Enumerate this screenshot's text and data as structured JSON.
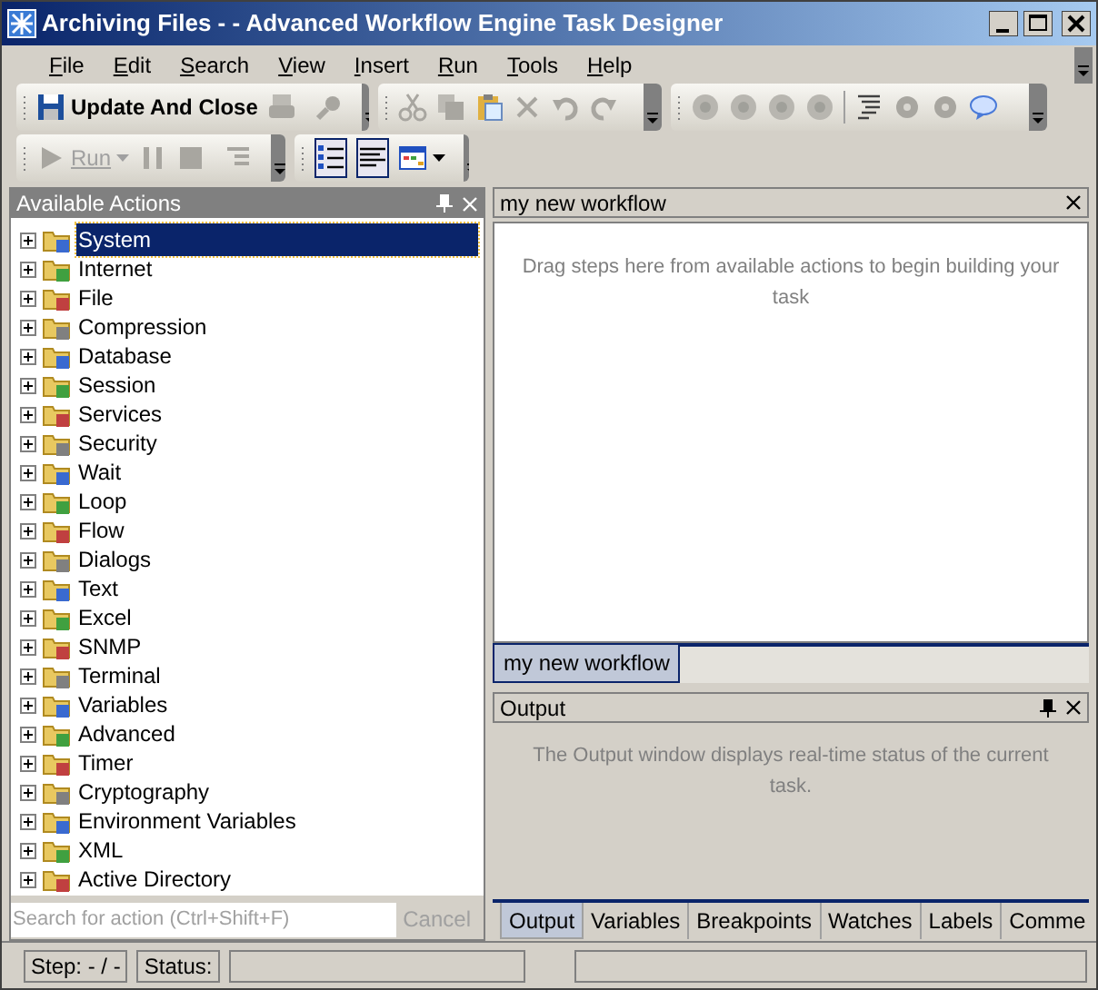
{
  "window": {
    "title": "Archiving Files -  - Advanced Workflow Engine Task Designer"
  },
  "menu": [
    "File",
    "Edit",
    "Search",
    "View",
    "Insert",
    "Run",
    "Tools",
    "Help"
  ],
  "toolbar": {
    "save_label": "Update And Close",
    "run_label": "Run",
    "view_buttons": [
      {
        "selected": true
      },
      {
        "selected": true
      }
    ]
  },
  "actions_panel": {
    "title": "Available Actions",
    "items": [
      {
        "label": "System",
        "selected": true
      },
      {
        "label": "Internet",
        "selected": false
      },
      {
        "label": "File",
        "selected": false
      },
      {
        "label": "Compression",
        "selected": false
      },
      {
        "label": "Database",
        "selected": false
      },
      {
        "label": "Session",
        "selected": false
      },
      {
        "label": "Services",
        "selected": false
      },
      {
        "label": "Security",
        "selected": false
      },
      {
        "label": "Wait",
        "selected": false
      },
      {
        "label": "Loop",
        "selected": false
      },
      {
        "label": "Flow",
        "selected": false
      },
      {
        "label": "Dialogs",
        "selected": false
      },
      {
        "label": "Text",
        "selected": false
      },
      {
        "label": "Excel",
        "selected": false
      },
      {
        "label": "SNMP",
        "selected": false
      },
      {
        "label": "Terminal",
        "selected": false
      },
      {
        "label": "Variables",
        "selected": false
      },
      {
        "label": "Advanced",
        "selected": false
      },
      {
        "label": "Timer",
        "selected": false
      },
      {
        "label": "Cryptography",
        "selected": false
      },
      {
        "label": "Environment Variables",
        "selected": false
      },
      {
        "label": "XML",
        "selected": false
      },
      {
        "label": "Active Directory",
        "selected": false
      }
    ],
    "search_placeholder": "Search for action (Ctrl+Shift+F)",
    "cancel_label": "Cancel"
  },
  "document": {
    "title": "my new workflow",
    "hint": "Drag steps here from available actions to begin building your task",
    "tabs": [
      {
        "label": "my new workflow",
        "selected": true
      }
    ]
  },
  "output": {
    "title": "Output",
    "hint": "The Output window displays real-time status of the current task.",
    "tabs": [
      {
        "label": "Output",
        "selected": true
      },
      {
        "label": "Variables",
        "selected": false
      },
      {
        "label": "Breakpoints",
        "selected": false
      },
      {
        "label": "Watches",
        "selected": false
      },
      {
        "label": "Labels",
        "selected": false
      },
      {
        "label": "Comme",
        "selected": false
      }
    ]
  },
  "status_bar": [
    "Step: - / -",
    "Status:"
  ]
}
